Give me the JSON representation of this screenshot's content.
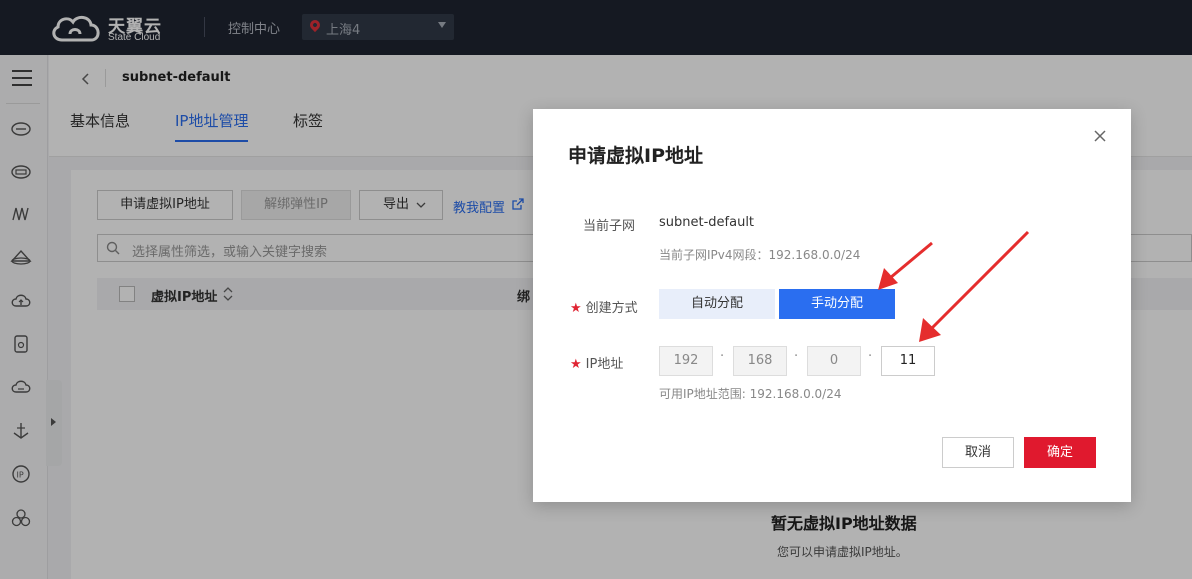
{
  "topbar": {
    "brand_name": "天翼云",
    "brand_sub": "State Cloud",
    "console_label": "控制中心",
    "region": "上海4"
  },
  "header": {
    "title": "subnet-default",
    "tabs": [
      {
        "label": "基本信息"
      },
      {
        "label": "IP地址管理"
      },
      {
        "label": "标签"
      }
    ]
  },
  "toolbar": {
    "apply_label": "申请虚拟IP地址",
    "unbind_label": "解绑弹性IP",
    "export_label": "导出",
    "guide_label": "教我配置"
  },
  "search": {
    "placeholder": "选择属性筛选，或输入关键字搜索"
  },
  "table": {
    "col_vip": "虚拟IP地址",
    "col_bind": "绑"
  },
  "empty": {
    "title": "暂无虚拟IP地址数据",
    "subtitle": "您可以申请虚拟IP地址。"
  },
  "modal": {
    "title": "申请虚拟IP地址",
    "subnet_label": "当前子网",
    "subnet_value": "subnet-default",
    "subnet_hint": "当前子网IPv4网段：192.168.0.0/24",
    "method_label": "创建方式",
    "method_auto": "自动分配",
    "method_manual": "手动分配",
    "ip_label": "IP地址",
    "ip_octets": [
      "192",
      "168",
      "0",
      "11"
    ],
    "ip_hint": "可用IP地址范围: 192.168.0.0/24",
    "cancel_label": "取消",
    "ok_label": "确定"
  },
  "colors": {
    "accent": "#2a6ef0",
    "danger": "#e0192e",
    "topbar": "#1f2531"
  }
}
